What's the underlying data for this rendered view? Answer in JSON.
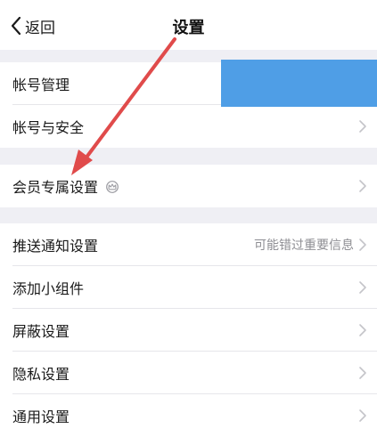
{
  "nav": {
    "back_label": "返回",
    "title": "设置"
  },
  "groups": [
    {
      "items": [
        {
          "label": "帐号管理"
        },
        {
          "label": "帐号与安全"
        }
      ]
    },
    {
      "items": [
        {
          "label": "会员专属设置",
          "badge_icon": "crown-icon"
        }
      ]
    },
    {
      "items": [
        {
          "label": "推送通知设置",
          "value": "可能错过重要信息"
        },
        {
          "label": "添加小组件"
        },
        {
          "label": "屏蔽设置"
        },
        {
          "label": "隐私设置"
        },
        {
          "label": "通用设置"
        }
      ]
    }
  ],
  "colors": {
    "background": "#efeff4",
    "highlight_block": "#4f9ee6",
    "annotation_arrow": "#e04b4b"
  }
}
